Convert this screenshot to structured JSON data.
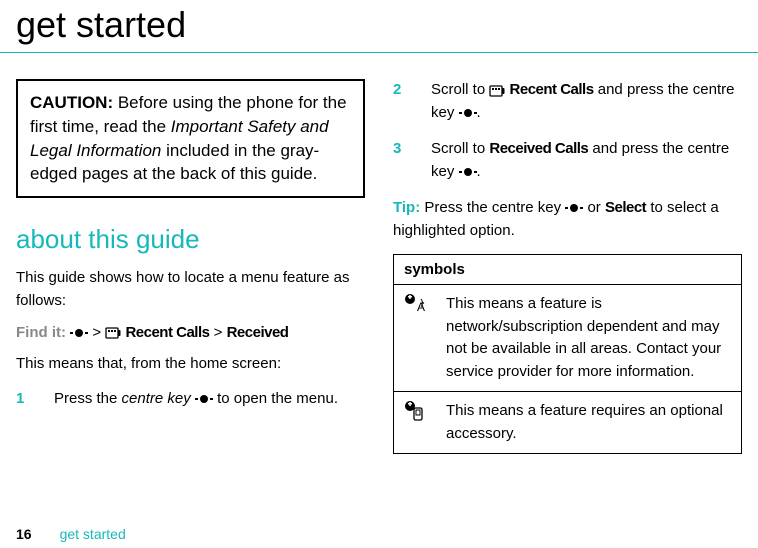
{
  "page": {
    "title": "get started",
    "number": "16",
    "footer_text": "get started"
  },
  "caution": {
    "label": "CAUTION:",
    "before": " Before using the phone for the first time, read the ",
    "italic": "Important Safety and Legal Information",
    "after": " included in the gray-edged pages at the back of this guide."
  },
  "about": {
    "heading": "about this guide",
    "intro": "This guide shows how to locate a menu feature as follows:",
    "find_label": "Find it:",
    "find_recent": "Recent Calls",
    "find_gt1": ">",
    "find_gt2": ">",
    "find_received": "Received",
    "means": "This means that, from the home screen:"
  },
  "steps": {
    "s1num": "1",
    "s1a": "Press the ",
    "s1i": "centre key",
    "s1b": " to open the menu.",
    "s2num": "2",
    "s2a": "Scroll to ",
    "s2recent": "Recent Calls",
    "s2b": " and press the centre key ",
    "s2c": ".",
    "s3num": "3",
    "s3a": "Scroll to ",
    "s3received": "Received Calls",
    "s3b": " and press the centre key ",
    "s3c": "."
  },
  "tip": {
    "label": "Tip:",
    "a": " Press the centre key ",
    "b": " or ",
    "select": "Select",
    "c": " to select a highlighted option."
  },
  "symbols": {
    "header": "symbols",
    "row1": "This means a feature is network/subscription dependent and may not be available in all areas. Contact your service provider for more information.",
    "row2": "This means a feature requires an optional accessory."
  }
}
